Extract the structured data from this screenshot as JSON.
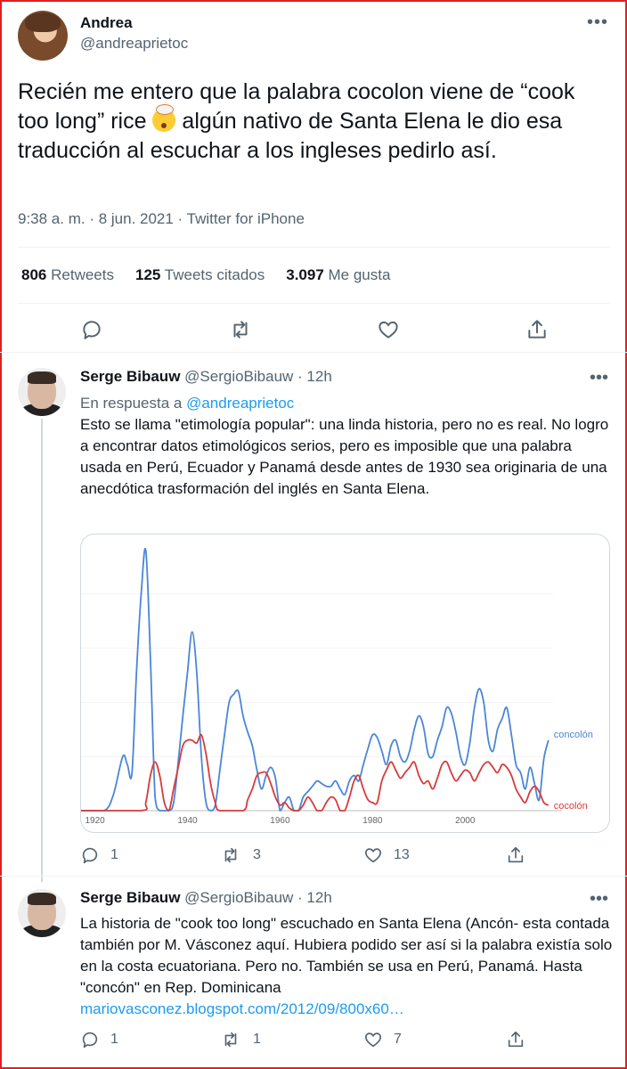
{
  "main_tweet": {
    "name": "Andrea",
    "handle": "@andreaprietoc",
    "text_1": "Recién me entero que la palabra cocolon viene de “cook too long” rice",
    "text_2": " algún nativo de Santa Elena le dio esa traducción al escuchar a los ingleses pedirlo así.",
    "meta": "9:38 a. m. · 8 jun. 2021 · Twitter for iPhone",
    "retweets": "806",
    "retweets_label": "Retweets",
    "quotes": "125",
    "quotes_label": "Tweets citados",
    "likes": "3.097",
    "likes_label": "Me gusta"
  },
  "reply_1": {
    "name": "Serge Bibauw",
    "handle_time": "@SergioBibauw · 12h",
    "in_reply_prefix": "En respuesta a ",
    "in_reply_handle": "@andreaprietoc",
    "text": "Esto se llama \"etimología popular\": una linda historia, pero no es real. No logro a encontrar datos etimológicos serios, pero es imposible que una palabra usada en Perú, Ecuador y Panamá desde antes de 1930 sea originaria de una anecdótica trasformación del inglés en Santa Elena.",
    "replies": "1",
    "retweets": "3",
    "likes": "13"
  },
  "reply_2": {
    "name": "Serge Bibauw",
    "handle_time": "@SergioBibauw · 12h",
    "text": "La historia de \"cook too long\" escuchado en Santa Elena (Ancón- esta contada también por M. Vásconez aquí. Hubiera podido ser así si la palabra existía solo en la costa ecuatoriana. Pero no. También se usa en Perú, Panamá. Hasta \"concón\" en Rep. Dominicana",
    "link": "mariovasconez.blogspot.com/2012/09/800x60…",
    "replies": "1",
    "retweets": "1",
    "likes": "7"
  },
  "icons": [
    "more-icon",
    "reply-icon",
    "retweet-icon",
    "like-icon",
    "share-icon",
    "mind-blown-emoji"
  ],
  "colors": {
    "link": "#1d9bf0",
    "concolon": "#4a86d8",
    "cocolon": "#d83b3b",
    "frame": "#e02020"
  },
  "chart_data": {
    "type": "line",
    "xlim": [
      1917,
      2019
    ],
    "ylim": [
      0,
      100
    ],
    "x_ticks": [
      "1920",
      "1940",
      "1960",
      "1980",
      "2000"
    ],
    "series": [
      {
        "name": "concolón",
        "color": "#4a86d8",
        "points": [
          [
            1917,
            0
          ],
          [
            1922,
            0
          ],
          [
            1924,
            6
          ],
          [
            1926,
            20
          ],
          [
            1927,
            17
          ],
          [
            1928,
            14
          ],
          [
            1929,
            52
          ],
          [
            1930,
            80
          ],
          [
            1931,
            96
          ],
          [
            1932,
            56
          ],
          [
            1933,
            5
          ],
          [
            1934,
            0
          ],
          [
            1936,
            0
          ],
          [
            1937,
            3
          ],
          [
            1938,
            18
          ],
          [
            1939,
            35
          ],
          [
            1940,
            51
          ],
          [
            1941,
            66
          ],
          [
            1942,
            51
          ],
          [
            1943,
            20
          ],
          [
            1944,
            3
          ],
          [
            1945,
            0
          ],
          [
            1946,
            2
          ],
          [
            1947,
            15
          ],
          [
            1948,
            28
          ],
          [
            1949,
            40
          ],
          [
            1950,
            43
          ],
          [
            1951,
            44
          ],
          [
            1952,
            35
          ],
          [
            1953,
            29
          ],
          [
            1954,
            24
          ],
          [
            1955,
            15
          ],
          [
            1956,
            8
          ],
          [
            1957,
            13
          ],
          [
            1958,
            16
          ],
          [
            1959,
            12
          ],
          [
            1960,
            0
          ],
          [
            1961,
            3
          ],
          [
            1962,
            5
          ],
          [
            1963,
            0
          ],
          [
            1964,
            0
          ],
          [
            1965,
            5
          ],
          [
            1966,
            7
          ],
          [
            1967,
            9
          ],
          [
            1968,
            11
          ],
          [
            1969,
            10
          ],
          [
            1970,
            9
          ],
          [
            1971,
            9
          ],
          [
            1972,
            11
          ],
          [
            1973,
            8
          ],
          [
            1974,
            6
          ],
          [
            1975,
            11
          ],
          [
            1976,
            13
          ],
          [
            1977,
            11
          ],
          [
            1978,
            17
          ],
          [
            1979,
            23
          ],
          [
            1980,
            28
          ],
          [
            1981,
            27
          ],
          [
            1982,
            22
          ],
          [
            1983,
            17
          ],
          [
            1984,
            24
          ],
          [
            1985,
            26
          ],
          [
            1986,
            20
          ],
          [
            1987,
            18
          ],
          [
            1988,
            22
          ],
          [
            1989,
            30
          ],
          [
            1990,
            35
          ],
          [
            1991,
            31
          ],
          [
            1992,
            21
          ],
          [
            1993,
            20
          ],
          [
            1994,
            26
          ],
          [
            1995,
            31
          ],
          [
            1996,
            38
          ],
          [
            1997,
            36
          ],
          [
            1998,
            29
          ],
          [
            1999,
            20
          ],
          [
            2000,
            17
          ],
          [
            2001,
            25
          ],
          [
            2002,
            38
          ],
          [
            2003,
            45
          ],
          [
            2004,
            40
          ],
          [
            2005,
            26
          ],
          [
            2006,
            22
          ],
          [
            2007,
            30
          ],
          [
            2008,
            34
          ],
          [
            2009,
            38
          ],
          [
            2010,
            28
          ],
          [
            2011,
            17
          ],
          [
            2012,
            14
          ],
          [
            2013,
            8
          ],
          [
            2014,
            16
          ],
          [
            2015,
            10
          ],
          [
            2016,
            4
          ],
          [
            2017,
            19
          ],
          [
            2018,
            26
          ]
        ]
      },
      {
        "name": "cocolón",
        "color": "#d83b3b",
        "points": [
          [
            1917,
            0
          ],
          [
            1930,
            0
          ],
          [
            1931,
            3
          ],
          [
            1932,
            13
          ],
          [
            1933,
            18
          ],
          [
            1934,
            13
          ],
          [
            1935,
            3
          ],
          [
            1936,
            0
          ],
          [
            1937,
            8
          ],
          [
            1938,
            16
          ],
          [
            1939,
            24
          ],
          [
            1940,
            26
          ],
          [
            1941,
            26
          ],
          [
            1942,
            25
          ],
          [
            1943,
            28
          ],
          [
            1944,
            21
          ],
          [
            1945,
            10
          ],
          [
            1946,
            3
          ],
          [
            1947,
            0
          ],
          [
            1952,
            0
          ],
          [
            1953,
            4
          ],
          [
            1954,
            8
          ],
          [
            1955,
            13
          ],
          [
            1956,
            14
          ],
          [
            1957,
            14
          ],
          [
            1958,
            10
          ],
          [
            1959,
            5
          ],
          [
            1960,
            2
          ],
          [
            1961,
            3
          ],
          [
            1962,
            1
          ],
          [
            1963,
            0
          ],
          [
            1964,
            0
          ],
          [
            1965,
            2
          ],
          [
            1966,
            5
          ],
          [
            1967,
            3
          ],
          [
            1968,
            0
          ],
          [
            1969,
            0
          ],
          [
            1970,
            3
          ],
          [
            1971,
            5
          ],
          [
            1972,
            4
          ],
          [
            1973,
            0
          ],
          [
            1974,
            0
          ],
          [
            1975,
            5
          ],
          [
            1976,
            11
          ],
          [
            1977,
            13
          ],
          [
            1978,
            8
          ],
          [
            1979,
            4
          ],
          [
            1980,
            3
          ],
          [
            1981,
            3
          ],
          [
            1982,
            11
          ],
          [
            1983,
            15
          ],
          [
            1984,
            18
          ],
          [
            1985,
            15
          ],
          [
            1986,
            12
          ],
          [
            1987,
            14
          ],
          [
            1988,
            16
          ],
          [
            1989,
            18
          ],
          [
            1990,
            13
          ],
          [
            1991,
            10
          ],
          [
            1992,
            11
          ],
          [
            1993,
            8
          ],
          [
            1994,
            12
          ],
          [
            1995,
            17
          ],
          [
            1996,
            18
          ],
          [
            1997,
            14
          ],
          [
            1998,
            11
          ],
          [
            1999,
            13
          ],
          [
            2000,
            15
          ],
          [
            2001,
            14
          ],
          [
            2002,
            11
          ],
          [
            2003,
            14
          ],
          [
            2004,
            17
          ],
          [
            2005,
            18
          ],
          [
            2006,
            16
          ],
          [
            2007,
            14
          ],
          [
            2008,
            17
          ],
          [
            2009,
            16
          ],
          [
            2010,
            13
          ],
          [
            2011,
            8
          ],
          [
            2012,
            5
          ],
          [
            2013,
            3
          ],
          [
            2014,
            7
          ],
          [
            2015,
            9
          ],
          [
            2016,
            7
          ],
          [
            2017,
            3
          ],
          [
            2018,
            2
          ]
        ]
      }
    ]
  }
}
